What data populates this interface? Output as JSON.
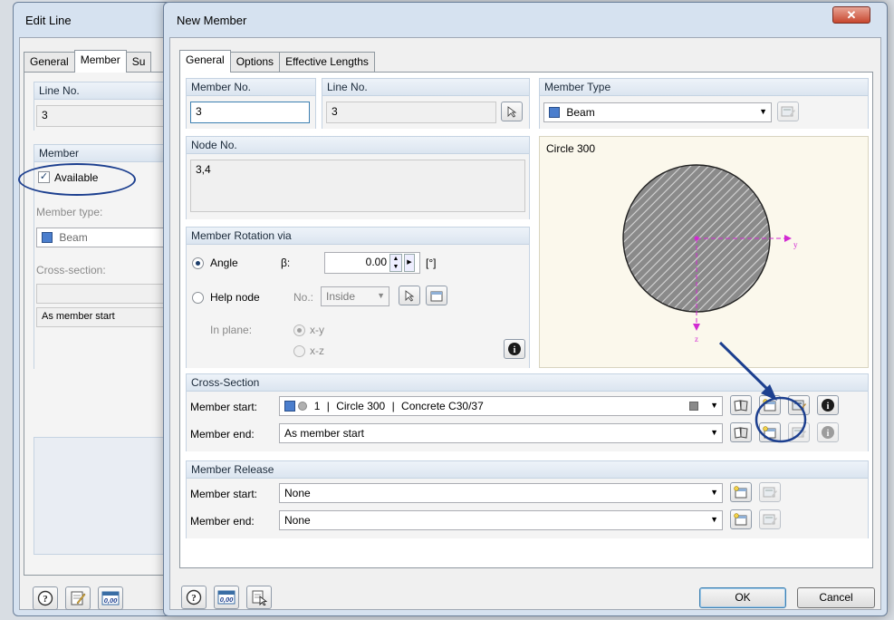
{
  "edit_line": {
    "title": "Edit Line",
    "tabs": [
      "General",
      "Member",
      "Su"
    ],
    "line_no": {
      "label": "Line No.",
      "value": "3"
    },
    "member_group": "Member",
    "available_label": "Available",
    "member_type_label": "Member type:",
    "member_type_value": "Beam",
    "cross_section_label": "Cross-section:",
    "as_member_start": "As member start"
  },
  "new_member": {
    "title": "New Member",
    "tabs": [
      "General",
      "Options",
      "Effective Lengths"
    ],
    "member_no": {
      "label": "Member No.",
      "value": "3"
    },
    "line_no": {
      "label": "Line No.",
      "value": "3"
    },
    "member_type": {
      "label": "Member Type",
      "value": "Beam"
    },
    "node_no": {
      "label": "Node No.",
      "value": "3,4"
    },
    "rotation": {
      "label": "Member Rotation via",
      "angle_label": "Angle",
      "beta_label": "β:",
      "beta_value": "0.00",
      "unit": "[°]",
      "help_node_label": "Help node",
      "no_label": "No.:",
      "no_value": "Inside",
      "in_plane_label": "In plane:",
      "plane_xy": "x-y",
      "plane_xz": "x-z"
    },
    "preview": {
      "title": "Circle 300",
      "axis_y": "y",
      "axis_z": "z"
    },
    "cross_section": {
      "label": "Cross-Section",
      "start_label": "Member start:",
      "start_no": "1",
      "start_name": "Circle 300",
      "start_material": "Concrete C30/37",
      "end_label": "Member end:",
      "end_value": "As member start"
    },
    "release": {
      "label": "Member Release",
      "start_label": "Member start:",
      "start_value": "None",
      "end_label": "Member end:",
      "end_value": "None"
    },
    "ok_label": "OK",
    "cancel_label": "Cancel"
  },
  "colors": {
    "accent": "#1c3f8f",
    "member_color": "#4b7ecd",
    "axis_color": "#d22ad2"
  }
}
